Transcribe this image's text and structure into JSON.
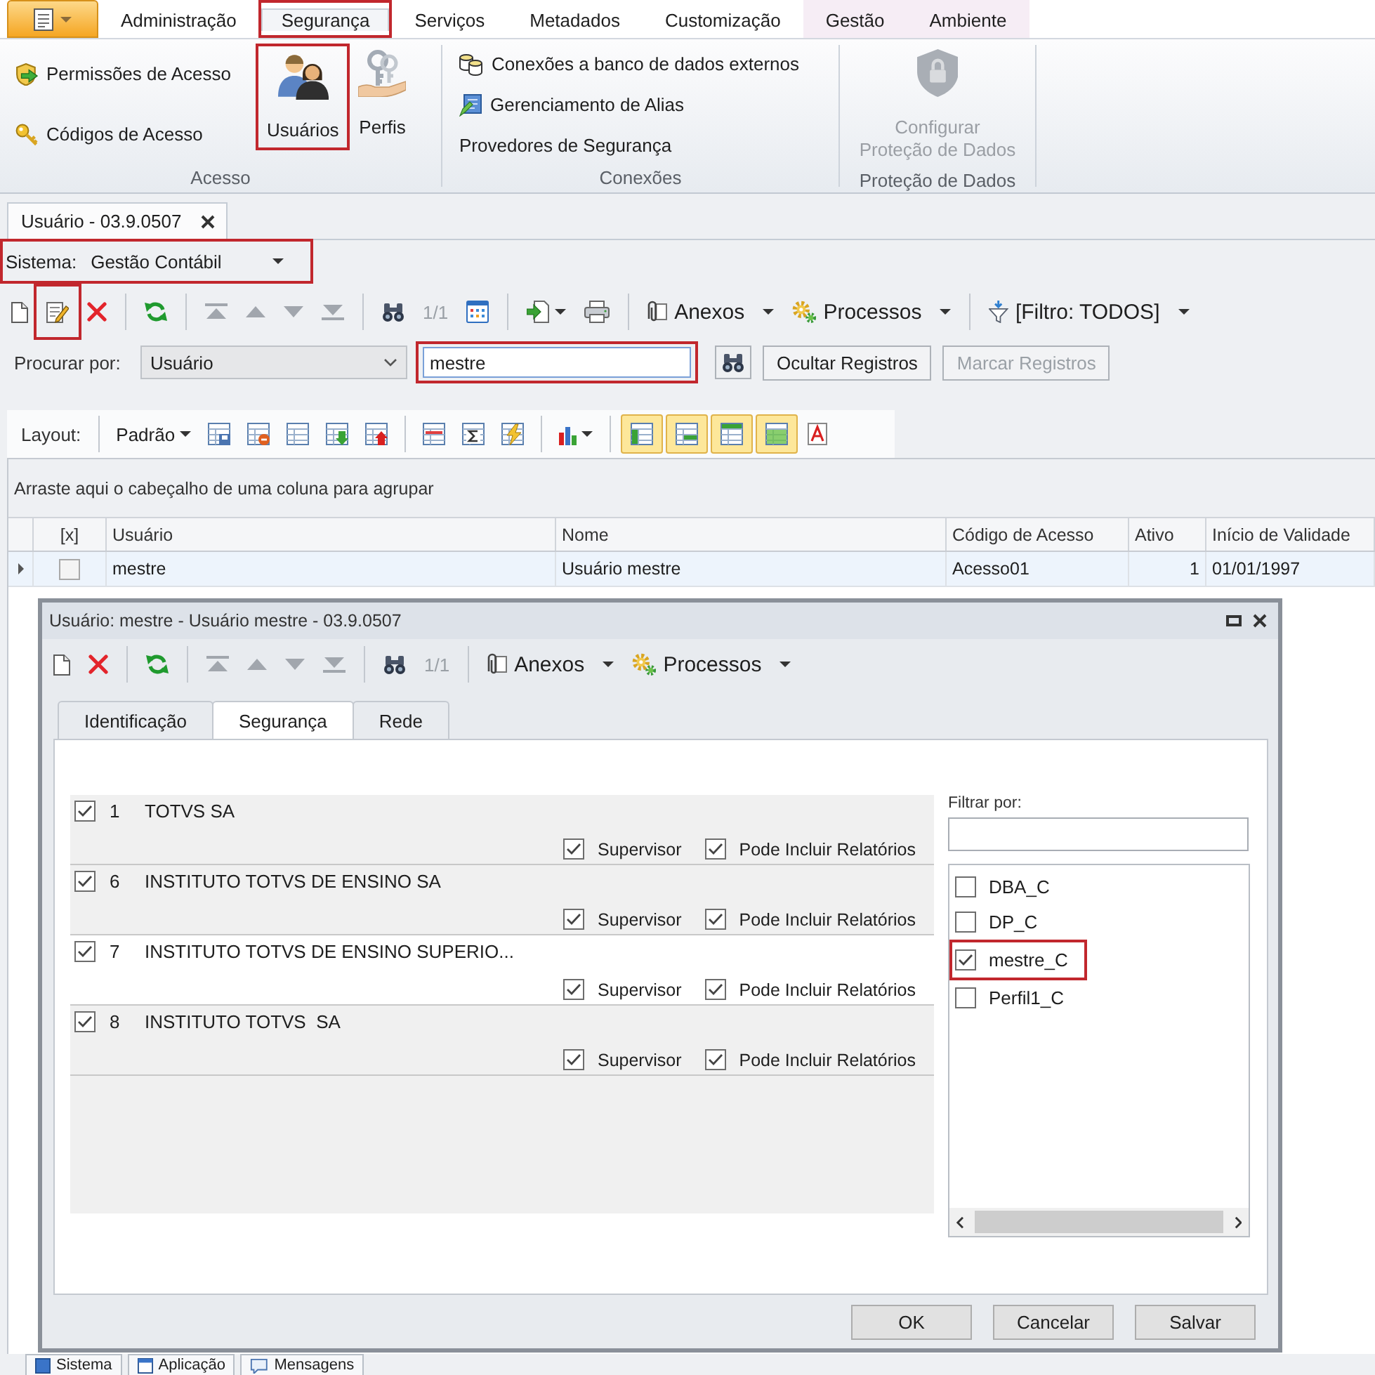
{
  "ribbon": {
    "tabs": [
      {
        "label": "Administração",
        "selected": false,
        "highlighted": false,
        "contextual": false
      },
      {
        "label": "Segurança",
        "selected": true,
        "highlighted": true,
        "contextual": false
      },
      {
        "label": "Serviços",
        "selected": false,
        "highlighted": false,
        "contextual": false
      },
      {
        "label": "Metadados",
        "selected": false,
        "highlighted": false,
        "contextual": false
      },
      {
        "label": "Customização",
        "selected": false,
        "highlighted": false,
        "contextual": false
      },
      {
        "label": "Gestão",
        "selected": false,
        "highlighted": false,
        "contextual": true
      },
      {
        "label": "Ambiente",
        "selected": false,
        "highlighted": false,
        "contextual": true
      }
    ],
    "groups": [
      {
        "label": "Acesso",
        "items": [
          {
            "kind": "small",
            "label": "Permissões de Acesso",
            "highlighted": false,
            "disabled": false
          },
          {
            "kind": "small",
            "label": "Códigos de Acesso",
            "highlighted": false,
            "disabled": false
          },
          {
            "kind": "large",
            "label": "Usuários",
            "highlighted": true,
            "disabled": false
          },
          {
            "kind": "large",
            "label": "Perfis",
            "highlighted": false,
            "disabled": false
          }
        ]
      },
      {
        "label": "Conexões",
        "items": [
          {
            "kind": "small",
            "label": "Conexões a banco de dados externos",
            "highlighted": false,
            "disabled": false
          },
          {
            "kind": "small",
            "label": "Gerenciamento de Alias",
            "highlighted": false,
            "disabled": false
          },
          {
            "kind": "text",
            "label": "Provedores de Segurança",
            "highlighted": false,
            "disabled": false
          }
        ]
      },
      {
        "label": "Proteção de Dados",
        "items": [
          {
            "kind": "large",
            "label": "Configurar\nProteção de Dados",
            "highlighted": false,
            "disabled": true
          }
        ]
      }
    ]
  },
  "document_tabs": [
    {
      "label": "Usuário - 03.9.0507",
      "selected": true
    }
  ],
  "system_selector": {
    "label": "Sistema:",
    "value": "Gestão Contábil",
    "highlighted": true
  },
  "toolbar": {
    "items": [
      {
        "kind": "icon",
        "disabled": false,
        "highlighted": false
      },
      {
        "kind": "icon",
        "disabled": false,
        "highlighted": true
      },
      {
        "kind": "icon",
        "disabled": false,
        "highlighted": false
      },
      {
        "kind": "separator"
      },
      {
        "kind": "icon",
        "disabled": false,
        "highlighted": false
      },
      {
        "kind": "separator"
      },
      {
        "kind": "icon",
        "disabled": true,
        "highlighted": false
      },
      {
        "kind": "icon",
        "disabled": true,
        "highlighted": false
      },
      {
        "kind": "icon",
        "disabled": true,
        "highlighted": false
      },
      {
        "kind": "icon",
        "disabled": true,
        "highlighted": false
      },
      {
        "kind": "separator"
      },
      {
        "kind": "icon",
        "disabled": false,
        "highlighted": false
      },
      {
        "kind": "counter",
        "text": "1/1",
        "disabled": true,
        "highlighted": false
      },
      {
        "kind": "icon",
        "disabled": false,
        "highlighted": false
      },
      {
        "kind": "separator"
      },
      {
        "kind": "icon_menu",
        "disabled": false,
        "highlighted": false
      },
      {
        "kind": "icon",
        "disabled": false,
        "highlighted": false
      },
      {
        "kind": "separator"
      },
      {
        "kind": "menu",
        "label": "Anexos",
        "disabled": false,
        "highlighted": false
      },
      {
        "kind": "menu",
        "label": "Processos",
        "disabled": false,
        "highlighted": false
      },
      {
        "kind": "separator"
      },
      {
        "kind": "menu",
        "label": "[Filtro: TODOS]",
        "disabled": false,
        "highlighted": false
      }
    ]
  },
  "search": {
    "label": "Procurar por:",
    "field": "Usuário",
    "value": "mestre",
    "highlighted": true,
    "buttons": [
      {
        "label": "Ocultar Registros",
        "disabled": false
      },
      {
        "label": "Marcar Registros",
        "disabled": true
      }
    ]
  },
  "layout_bar": {
    "label": "Layout:",
    "preset": "Padrão",
    "items": [
      {
        "kind": "icon",
        "on": false
      },
      {
        "kind": "icon",
        "on": false
      },
      {
        "kind": "icon",
        "on": false
      },
      {
        "kind": "icon",
        "on": false
      },
      {
        "kind": "icon",
        "on": false
      },
      {
        "kind": "separator"
      },
      {
        "kind": "icon",
        "on": false
      },
      {
        "kind": "icon",
        "on": false
      },
      {
        "kind": "icon",
        "on": false
      },
      {
        "kind": "separator"
      },
      {
        "kind": "icon_menu",
        "on": false
      },
      {
        "kind": "separator"
      },
      {
        "kind": "icon",
        "on": true
      },
      {
        "kind": "icon",
        "on": true
      },
      {
        "kind": "icon",
        "on": true
      },
      {
        "kind": "icon",
        "on": true
      },
      {
        "kind": "icon",
        "on": false
      }
    ]
  },
  "grid": {
    "group_hint": "Arraste aqui o cabeçalho de uma coluna para agrupar",
    "check_column": "[x]",
    "columns": [
      "Usuário",
      "Nome",
      "Código de Acesso",
      "Ativo",
      "Início de Validade"
    ],
    "rows": [
      {
        "selected": true,
        "checked": false,
        "cells": [
          "mestre",
          "Usuário mestre",
          "Acesso01",
          "1",
          "01/01/1997"
        ]
      }
    ]
  },
  "dialog": {
    "title": "Usuário: mestre - Usuário mestre - 03.9.0507",
    "toolbar": {
      "items": [
        {
          "kind": "icon",
          "disabled": false,
          "highlighted": false
        },
        {
          "kind": "icon",
          "disabled": false,
          "highlighted": false
        },
        {
          "kind": "separator"
        },
        {
          "kind": "icon",
          "disabled": false,
          "highlighted": false
        },
        {
          "kind": "separator"
        },
        {
          "kind": "icon",
          "disabled": true,
          "highlighted": false
        },
        {
          "kind": "icon",
          "disabled": true,
          "highlighted": false
        },
        {
          "kind": "icon",
          "disabled": true,
          "highlighted": false
        },
        {
          "kind": "icon",
          "disabled": true,
          "highlighted": false
        },
        {
          "kind": "separator"
        },
        {
          "kind": "icon",
          "disabled": false,
          "highlighted": false
        },
        {
          "kind": "counter",
          "text": "1/1",
          "disabled": true,
          "highlighted": false
        },
        {
          "kind": "separator"
        },
        {
          "kind": "menu",
          "label": "Anexos",
          "disabled": false,
          "highlighted": false
        },
        {
          "kind": "menu",
          "label": "Processos",
          "disabled": false,
          "highlighted": false
        }
      ]
    },
    "tabs": [
      {
        "label": "Identificação",
        "selected": false
      },
      {
        "label": "Segurança",
        "selected": true
      },
      {
        "label": "Rede",
        "selected": false
      }
    ],
    "companies": [
      {
        "checked": true,
        "code": "1",
        "name": "TOTVS SA",
        "selected": false,
        "options": [
          {
            "label": "Supervisor",
            "checked": true
          },
          {
            "label": "Pode Incluir Relatórios",
            "checked": true
          }
        ]
      },
      {
        "checked": true,
        "code": "6",
        "name": "INSTITUTO TOTVS DE ENSINO SA",
        "selected": false,
        "options": [
          {
            "label": "Supervisor",
            "checked": true
          },
          {
            "label": "Pode Incluir Relatórios",
            "checked": true
          }
        ]
      },
      {
        "checked": true,
        "code": "7",
        "name": "INSTITUTO TOTVS DE ENSINO SUPERIO...",
        "selected": true,
        "options": [
          {
            "label": "Supervisor",
            "checked": true
          },
          {
            "label": "Pode Incluir Relatórios",
            "checked": true
          }
        ]
      },
      {
        "checked": true,
        "code": "8",
        "name": "INSTITUTO TOTVS  SA",
        "selected": false,
        "options": [
          {
            "label": "Supervisor",
            "checked": true
          },
          {
            "label": "Pode Incluir Relatórios",
            "checked": true
          }
        ]
      }
    ],
    "filter": {
      "label": "Filtrar por:"
    },
    "profiles": [
      {
        "label": "DBA_C",
        "checked": false,
        "highlighted": false
      },
      {
        "label": "DP_C",
        "checked": false,
        "highlighted": false
      },
      {
        "label": "mestre_C",
        "checked": true,
        "highlighted": true
      },
      {
        "label": "Perfil1_C",
        "checked": false,
        "highlighted": false
      }
    ],
    "buttons": [
      {
        "label": "OK"
      },
      {
        "label": "Cancelar"
      },
      {
        "label": "Salvar"
      }
    ]
  },
  "bottom_tabs": [
    {
      "label": "Sistema"
    },
    {
      "label": "Aplicação"
    },
    {
      "label": "Mensagens"
    }
  ]
}
